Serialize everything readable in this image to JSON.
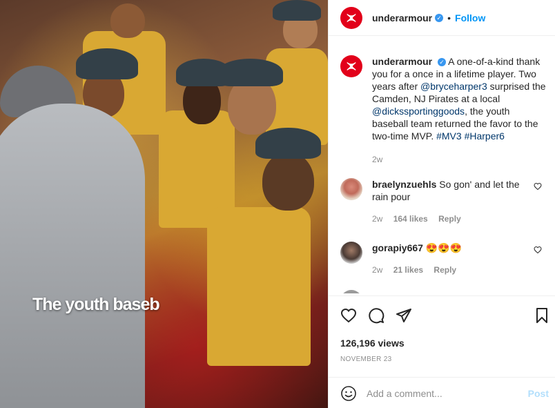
{
  "media": {
    "overlay_caption": "The youth baseb"
  },
  "header": {
    "username": "underarmour",
    "separator": "•",
    "follow_label": "Follow",
    "logo_color": "#e2001a"
  },
  "caption": {
    "username": "underarmour",
    "text_1": "A one-of-a-kind thank you for a once in a lifetime player. Two years after ",
    "mention_1": "@bryceharper3",
    "text_2": " surprised the Camden, NJ Pirates at a local ",
    "mention_2": "@dickssportinggoods",
    "text_3": ", the youth baseball team returned the favor to the two-time MVP. ",
    "hashtag_1": "#MV3",
    "hashtag_2": "#Harper6",
    "age": "2w"
  },
  "comments": [
    {
      "username": "braelynzuehls",
      "text": "So gon' and let the rain pour",
      "age": "2w",
      "likes": "164 likes",
      "reply": "Reply"
    },
    {
      "username": "gorapiy667",
      "text": "😍😍😍",
      "age": "2w",
      "likes": "21 likes",
      "reply": "Reply"
    }
  ],
  "actions": {
    "views": "126,196 views",
    "date": "NOVEMBER 23"
  },
  "comment_box": {
    "placeholder": "Add a comment...",
    "post_label": "Post"
  },
  "colors": {
    "link": "#00376b",
    "follow": "#0095f6",
    "post_disabled": "#b2dffc"
  },
  "icons": [
    "heart-icon",
    "comment-icon",
    "share-icon",
    "bookmark-icon",
    "emoji-icon",
    "verified-icon"
  ]
}
